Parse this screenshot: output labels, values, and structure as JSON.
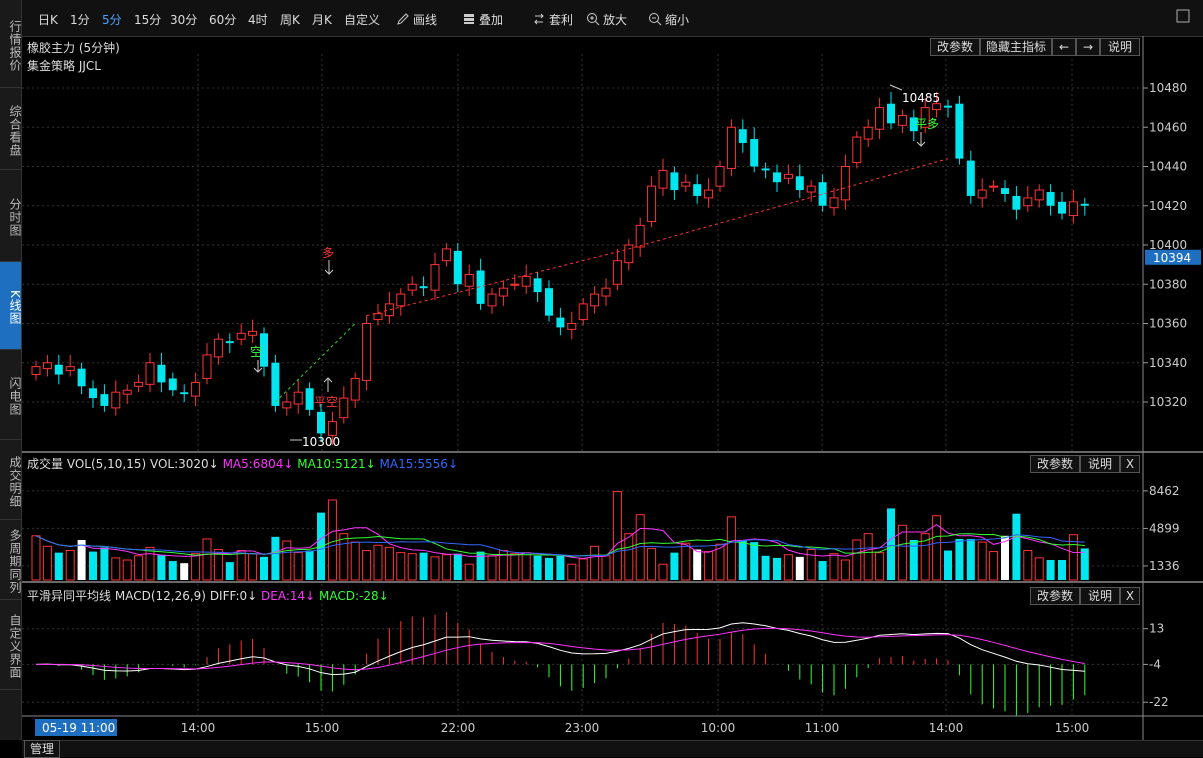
{
  "left_nav": [
    {
      "label": "行情报价",
      "active": false
    },
    {
      "label": "综合看盘",
      "active": false
    },
    {
      "label": "分时图",
      "active": false
    },
    {
      "label": "K线图",
      "active": true
    },
    {
      "label": "闪电图",
      "active": false
    },
    {
      "label": "成交明细",
      "active": false
    },
    {
      "label": "多周期同列",
      "active": false
    },
    {
      "label": "自定义界面",
      "active": false
    }
  ],
  "toolbar": {
    "periods": [
      "日K",
      "1分",
      "5分",
      "15分",
      "30分",
      "60分",
      "4时",
      "周K",
      "月K",
      "自定义"
    ],
    "active_period": "5分",
    "tools": [
      {
        "label": "画线",
        "icon": "pencil-icon"
      },
      {
        "label": "叠加",
        "icon": "stack-icon"
      },
      {
        "label": "套利",
        "icon": "arbitrage-icon"
      },
      {
        "label": "放大",
        "icon": "zoom-in-icon"
      },
      {
        "label": "缩小",
        "icon": "zoom-out-icon"
      }
    ]
  },
  "main_panel": {
    "title": "橡胶主力 (5分钟)",
    "strategy": "集金策略 JJCL",
    "buttons": [
      "改参数",
      "隐藏主指标",
      "←",
      "→",
      "说明"
    ],
    "price_ticks": [
      "10480",
      "10460",
      "10440",
      "10420",
      "10400",
      "10380",
      "10360",
      "10340",
      "10320"
    ],
    "current_price": "10394",
    "high_label": "10485",
    "low_label": "10300",
    "signals": {
      "short": "空",
      "long": "多",
      "close_short": "平空",
      "close_long": "平多"
    }
  },
  "volume_panel": {
    "title": "成交量",
    "vol_label": "VOL(5,10,15)",
    "vol_value": "VOL:3020↓",
    "ma5": "MA5:6804↓",
    "ma10": "MA10:5121↓",
    "ma15": "MA15:5556↓",
    "ticks": [
      "8462",
      "4899",
      "1336"
    ],
    "buttons": [
      "改参数",
      "说明",
      "X"
    ]
  },
  "macd_panel": {
    "title": "平滑异同平均线",
    "macd_label": "MACD(12,26,9)",
    "diff": "DIFF:0↓",
    "dea": "DEA:14↓",
    "macd": "MACD:-28↓",
    "ticks": [
      "13",
      "-4",
      "-22"
    ],
    "buttons": [
      "改参数",
      "说明",
      "X"
    ]
  },
  "time_axis": {
    "current": "05-19 11:00",
    "labels": [
      "14:00",
      "15:00",
      "22:00",
      "23:00",
      "10:00",
      "11:00",
      "14:00",
      "15:00"
    ]
  },
  "bottom": {
    "manage": "管理"
  },
  "colors": {
    "up": "#ff3333",
    "down": "#00e5ee",
    "ma5": "#ff33ff",
    "ma10": "#33ff33",
    "ma15": "#3366ff",
    "active_nav": "#1f6fc1",
    "accent": "#4aa3ff"
  },
  "chart_data": {
    "type": "candlestick",
    "closes": [
      10338,
      10340,
      10334,
      10338,
      10328,
      10322,
      10318,
      10325,
      10326,
      10330,
      10340,
      10330,
      10326,
      10324,
      10330,
      10344,
      10352,
      10350,
      10355,
      10356,
      10338,
      10318,
      10320,
      10325,
      10316,
      10304,
      10310,
      10322,
      10332,
      10360,
      10365,
      10370,
      10375,
      10380,
      10378,
      10390,
      10398,
      10380,
      10385,
      10370,
      10375,
      10378,
      10380,
      10384,
      10376,
      10364,
      10358,
      10360,
      10370,
      10375,
      10378,
      10392,
      10400,
      10410,
      10430,
      10438,
      10428,
      10432,
      10425,
      10428,
      10440,
      10460,
      10452,
      10440,
      10438,
      10432,
      10436,
      10428,
      10430,
      10420,
      10424,
      10440,
      10455,
      10460,
      10470,
      10462,
      10466,
      10458,
      10470,
      10472,
      10470,
      10444,
      10425,
      10428,
      10430,
      10426,
      10418,
      10424,
      10428,
      10420,
      10416,
      10422,
      10420
    ],
    "volumes": [
      4200,
      3200,
      2600,
      2800,
      3800,
      2700,
      3100,
      2100,
      1900,
      2300,
      3100,
      2400,
      1800,
      1600,
      2500,
      3900,
      2900,
      1700,
      2800,
      2500,
      2200,
      4100,
      3700,
      2600,
      2800,
      6400,
      7600,
      4400,
      3600,
      2800,
      3300,
      3100,
      2600,
      2500,
      2600,
      2200,
      2400,
      2500,
      1500,
      2700,
      2300,
      2800,
      2500,
      2600,
      2300,
      2100,
      2300,
      1500,
      2000,
      3200,
      2300,
      8400,
      4400,
      6200,
      3000,
      1500,
      2600,
      3500,
      2900,
      2700,
      3400,
      6000,
      3800,
      3600,
      2300,
      2100,
      2400,
      2200,
      2900,
      1800,
      2500,
      1900,
      3800,
      4400,
      2600,
      6800,
      5200,
      3800,
      4400,
      6100,
      2800,
      3900,
      3900,
      3600,
      2700,
      4200,
      6300,
      2800,
      2100,
      1900,
      1900,
      4300,
      3000
    ]
  }
}
